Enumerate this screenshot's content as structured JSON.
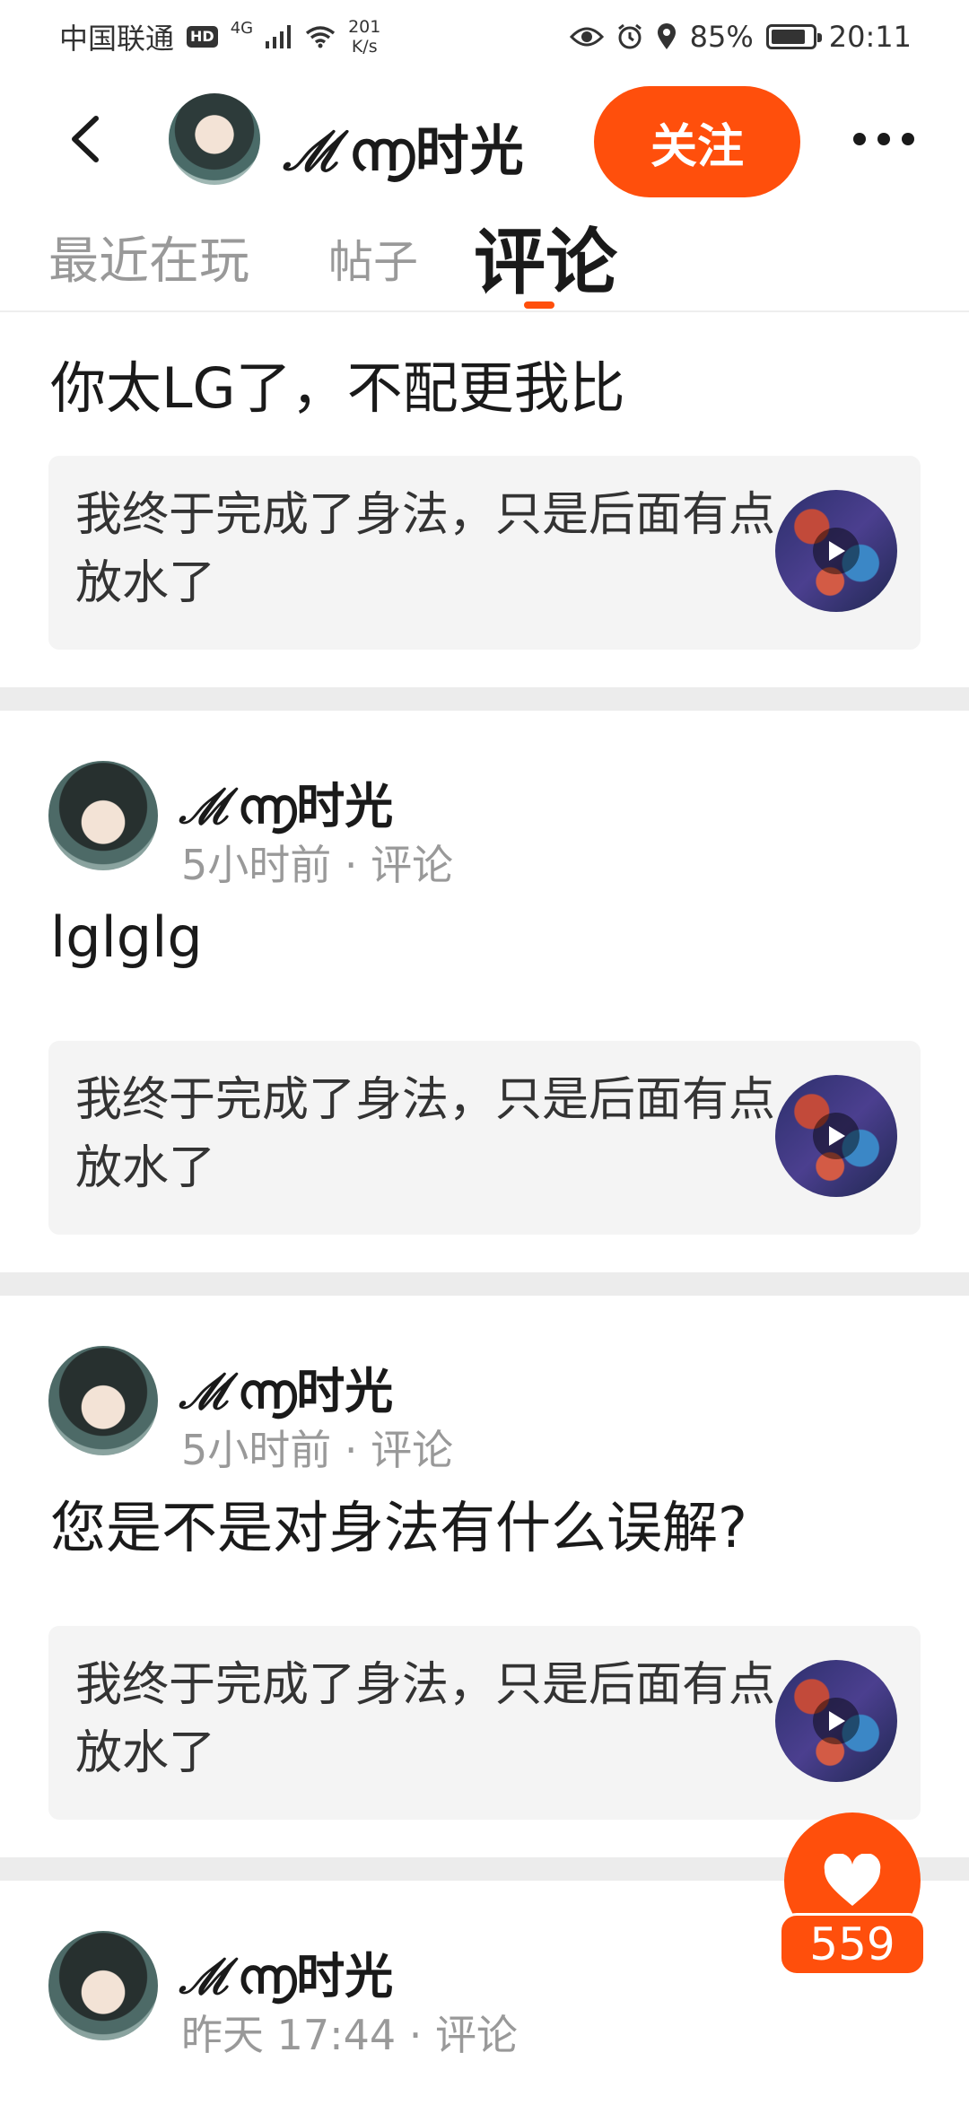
{
  "status_bar": {
    "carrier": "中国联通",
    "hd": "HD",
    "network": "4G",
    "speed_value": "201",
    "speed_unit": "K/s",
    "battery": "85%",
    "battery_level": 0.85,
    "time": "20:11"
  },
  "header": {
    "username": "ℳ൬时光",
    "follow_label": "关注"
  },
  "tabs": [
    {
      "label": "最近在玩"
    },
    {
      "label": "帖子"
    },
    {
      "label": "评论",
      "active": true
    }
  ],
  "feed": [
    {
      "comment": "你太LG了，不配更我比",
      "quote": "我终于完成了身法，只是后面有点放水了"
    },
    {
      "user": "ℳ൬时光",
      "meta": "5小时前 · 评论",
      "comment": "lglglg",
      "quote": "我终于完成了身法，只是后面有点放水了"
    },
    {
      "user": "ℳ൬时光",
      "meta": "5小时前 · 评论",
      "comment": "您是不是对身法有什么误解?",
      "quote": "我终于完成了身法，只是后面有点放水了"
    },
    {
      "user": "ℳ൬时光",
      "meta": "昨天 17:44 · 评论"
    }
  ],
  "like": {
    "count": "559"
  },
  "colors": {
    "accent": "#ff4f0c",
    "divider": "#ececec",
    "quote_bg": "#f4f4f4",
    "muted_text": "#999999"
  }
}
